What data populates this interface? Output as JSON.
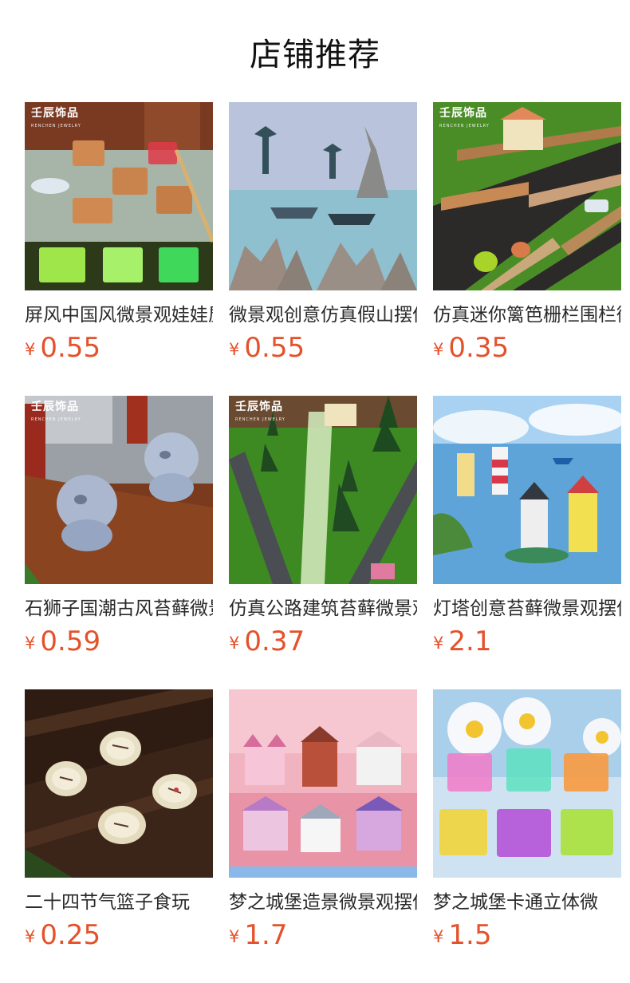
{
  "header": {
    "title": "店铺推荐"
  },
  "brand": {
    "mark": "壬辰饰品",
    "sub": "RENCHEN JEWELRY"
  },
  "products": [
    {
      "name": "屏风中国风微景观娃娃屋摆件",
      "price_symbol": "¥",
      "price": "0.55",
      "branded": true
    },
    {
      "name": "微景观创意仿真假山摆件",
      "price_symbol": "¥",
      "price": "0.55",
      "branded": false
    },
    {
      "name": "仿真迷你篱笆栅栏围栏微景观",
      "price_symbol": "¥",
      "price": "0.35",
      "branded": true
    },
    {
      "name": "石狮子国潮古风苔藓微景观",
      "price_symbol": "¥",
      "price": "0.59",
      "branded": true
    },
    {
      "name": "仿真公路建筑苔藓微景观",
      "price_symbol": "¥",
      "price": "0.37",
      "branded": true
    },
    {
      "name": "灯塔创意苔藓微景观摆件",
      "price_symbol": "¥",
      "price": "2.1",
      "branded": false
    },
    {
      "name": "二十四节气篮子食玩",
      "price_symbol": "¥",
      "price": "0.25",
      "branded": false
    },
    {
      "name": "梦之城堡造景微景观摆件",
      "price_symbol": "¥",
      "price": "1.7",
      "branded": false
    },
    {
      "name": "梦之城堡卡通立体微",
      "price_symbol": "¥",
      "price": "1.5",
      "branded": false
    }
  ]
}
